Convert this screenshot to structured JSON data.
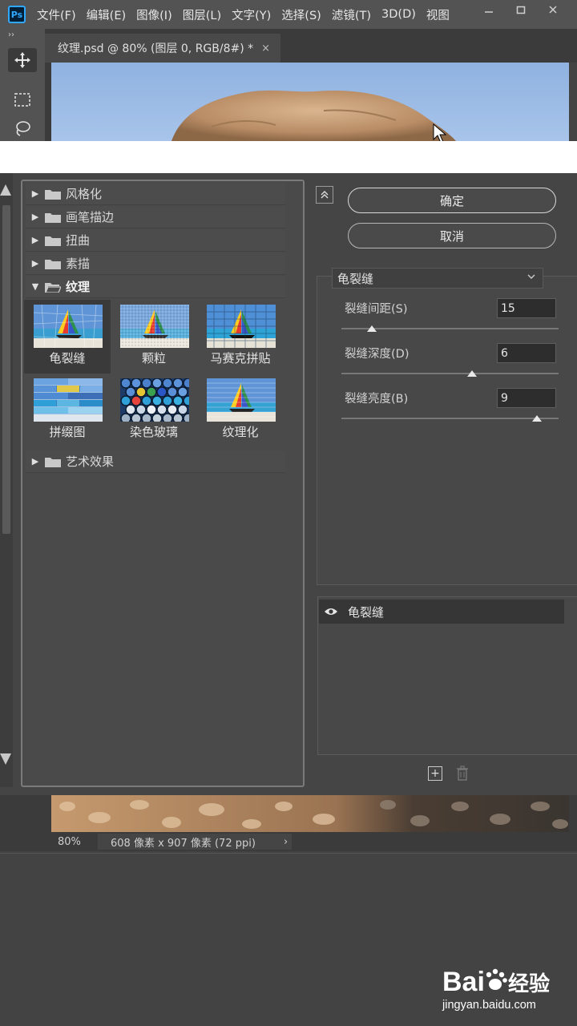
{
  "app": {
    "logo": "Ps",
    "menus": [
      "文件(F)",
      "编辑(E)",
      "图像(I)",
      "图层(L)",
      "文字(Y)",
      "选择(S)",
      "滤镜(T)",
      "3D(D)",
      "视图"
    ],
    "window_controls": [
      "minimize-icon",
      "restore-icon",
      "close-icon"
    ],
    "collapse_glyph": "››"
  },
  "document": {
    "tab_title": "纹理.psd @ 80% (图层 0, RGB/8#) *",
    "tab_close": "×"
  },
  "gallery": {
    "categories_top": [
      {
        "label": "风格化",
        "expanded": false
      },
      {
        "label": "画笔描边",
        "expanded": false
      },
      {
        "label": "扭曲",
        "expanded": false
      },
      {
        "label": "素描",
        "expanded": false
      },
      {
        "label": "纹理",
        "expanded": true
      }
    ],
    "texture_filters": [
      "龟裂缝",
      "颗粒",
      "马赛克拼贴",
      "拼缀图",
      "染色玻璃",
      "纹理化"
    ],
    "selected_filter": "龟裂缝",
    "categories_bottom": [
      {
        "label": "艺术效果",
        "expanded": false
      }
    ]
  },
  "panel": {
    "ok_label": "确定",
    "cancel_label": "取消",
    "selected_filter": "龟裂缝",
    "params": [
      {
        "label": "裂缝间距(S)",
        "value": "15",
        "slider": 0.14
      },
      {
        "label": "裂缝深度(D)",
        "value": "6",
        "slider": 0.6
      },
      {
        "label": "裂缝亮度(B)",
        "value": "9",
        "slider": 0.9
      }
    ]
  },
  "layers": {
    "items": [
      {
        "name": "龟裂缝",
        "visible": true
      }
    ]
  },
  "status": {
    "zoom": "80%",
    "doc_size": "608 像素 x 907 像素 (72 ppi)",
    "arrow": "›"
  },
  "watermark": {
    "url": "jingyan.baidu.com"
  },
  "colors": {
    "ps_blue": "#31a8ff",
    "chrome": "#535353",
    "panel": "#454545"
  }
}
